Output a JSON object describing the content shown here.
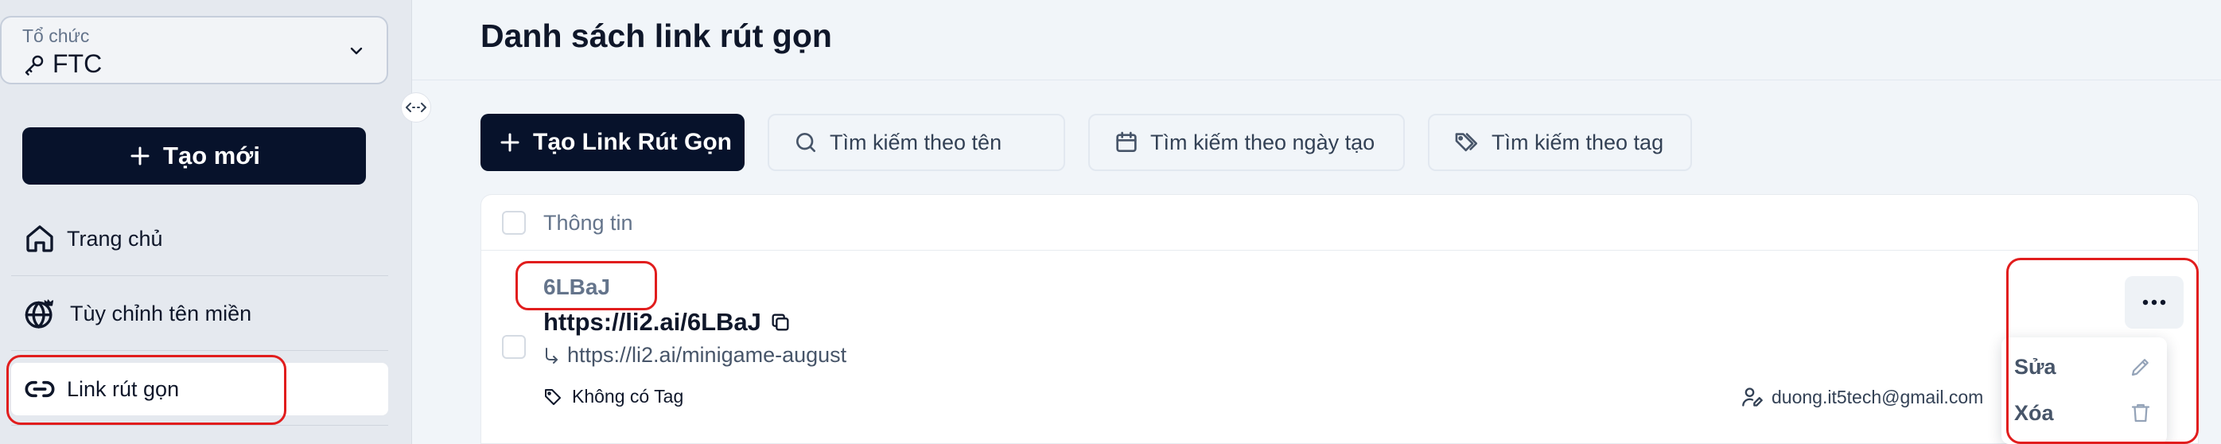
{
  "sidebar": {
    "org": {
      "label": "Tổ chức",
      "value": "FTC"
    },
    "create_label": "Tạo mới",
    "items": [
      {
        "label": "Trang chủ",
        "icon": "home-icon"
      },
      {
        "label": "Tùy chỉnh tên miền",
        "icon": "globe-crown-icon"
      },
      {
        "label": "Link rút gọn",
        "icon": "link-icon",
        "active": true
      }
    ]
  },
  "main": {
    "title": "Danh sách link rút gọn",
    "toolbar": {
      "create_label": "Tạo Link Rút Gọn",
      "search_name": "Tìm kiếm theo tên",
      "search_date": "Tìm kiếm theo ngày tạo",
      "search_tag": "Tìm kiếm theo tag"
    },
    "table": {
      "header": "Thông tin",
      "rows": [
        {
          "code": "6LBaJ",
          "short_url": "https://li2.ai/6LBaJ",
          "long_url": "https://li2.ai/minigame-august",
          "tag": "Không có Tag",
          "owner": "duong.it5tech@gmail.com"
        }
      ]
    },
    "menu": {
      "edit_label": "Sửa",
      "delete_label": "Xóa"
    }
  },
  "colors": {
    "primary": "#07122b",
    "highlight": "#e11d1d",
    "sidebar_bg": "#e5e9ef",
    "page_bg": "#f1f5f9"
  }
}
